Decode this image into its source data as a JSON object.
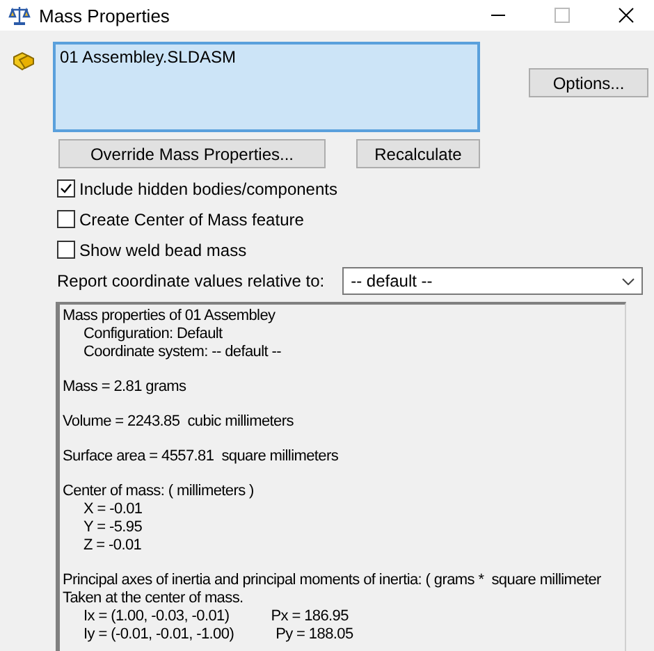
{
  "window": {
    "title": "Mass Properties"
  },
  "selection_list": {
    "items": [
      {
        "text": "01 Assembley.SLDASM"
      }
    ]
  },
  "buttons": {
    "options": "Options...",
    "override": "Override Mass Properties...",
    "recalculate": "Recalculate"
  },
  "checkboxes": [
    {
      "label": "Include hidden bodies/components",
      "checked": true
    },
    {
      "label": "Create Center of Mass feature",
      "checked": false
    },
    {
      "label": "Show weld bead mass",
      "checked": false
    }
  ],
  "coordinate_system": {
    "label": "Report coordinate values relative to:",
    "value": "-- default --"
  },
  "report": [
    [
      {
        "text": "Mass properties of 01 Assembley",
        "children": [
          {
            "text": "Configuration: Default"
          },
          {
            "text": "Coordinate system: -- default --"
          }
        ]
      }
    ],
    [
      {
        "text": "Mass = 2.81 grams"
      }
    ],
    [
      {
        "text": "Volume = 2243.85  cubic millimeters"
      }
    ],
    [
      {
        "text": "Surface area = 4557.81  square millimeters"
      }
    ],
    [
      {
        "text": "Center of mass: ( millimeters )",
        "children": [
          {
            "text": "X = -0.01"
          },
          {
            "text": "Y = -5.95"
          },
          {
            "text": "Z = -0.01"
          }
        ]
      }
    ],
    [
      {
        "text": "Principal axes of inertia and principal moments of inertia: ( grams *  square millimeter"
      },
      {
        "text": "Taken at the center of mass.",
        "children": [
          {
            "text": "Ix = (1.00, -0.03, -0.01)",
            "value": "Px = 186.95"
          },
          {
            "text": "Iy = (-0.01, -0.01, -1.00)",
            "value": "Py = 188.05"
          }
        ]
      }
    ]
  ]
}
